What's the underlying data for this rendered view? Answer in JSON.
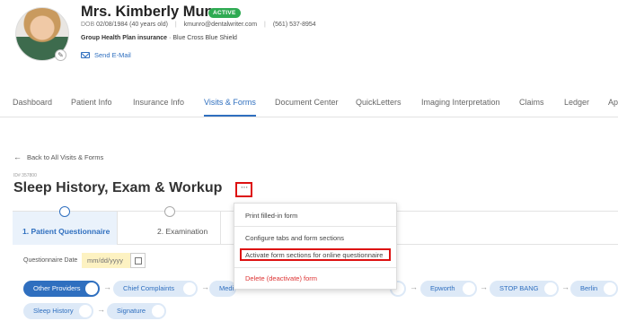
{
  "patient": {
    "name": "Mrs. Kimberly Munro",
    "status": "ACTIVE",
    "dob_label": "DOB",
    "dob": "02/08/1984",
    "age": "(40 years old)",
    "email": "kmunro@dentalwriter.com",
    "phone": "(561) 537-8954",
    "insurance_type": "Group Health Plan insurance",
    "insurance_sep": "·",
    "insurance_provider": "Blue Cross Blue Shield",
    "send_email_label": "Send E-Mail"
  },
  "nav": {
    "items": [
      "Dashboard",
      "Patient Info",
      "Insurance Info",
      "Visits & Forms",
      "Document Center",
      "QuickLetters",
      "Imaging Interpretation",
      "Claims",
      "Ledger",
      "Ap"
    ],
    "active": "Visits & Forms"
  },
  "back_label": "Back to All Visits & Forms",
  "form_id": "ID# 357800",
  "form_title": "Sleep History, Exam & Workup",
  "more_button_label": "···",
  "tabs": [
    {
      "label": "1. Patient Questionnaire"
    },
    {
      "label": "2. Examination"
    }
  ],
  "questionnaire_date": {
    "label": "Questionnaire Date",
    "placeholder": "mm/dd/yyyy"
  },
  "sections": [
    {
      "label": "Other Providers"
    },
    {
      "label": "Chief Complaints"
    },
    {
      "label": "Medi"
    },
    {
      "label": "Epworth"
    },
    {
      "label": "STOP BANG"
    },
    {
      "label": "Berlin"
    },
    {
      "label": "Sleep History"
    },
    {
      "label": "Signature"
    }
  ],
  "menu": {
    "items": [
      "Print filled-in form",
      "Configure tabs and form sections",
      "Activate form sections for online questionnaire",
      "Delete (deactivate) form"
    ]
  },
  "colors": {
    "accent": "#2f6fbf",
    "active_badge": "#2eaa52",
    "highlight_box": "#dd1111",
    "danger": "#dd3333",
    "date_input_bg": "#fdf2c2"
  }
}
